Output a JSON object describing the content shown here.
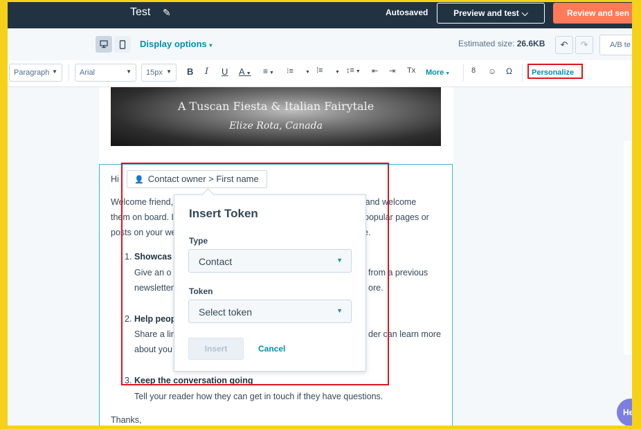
{
  "header": {
    "title": "Test",
    "autosaved": "Autosaved",
    "preview_label": "Preview and test",
    "review_label": "Review and sen"
  },
  "subbar": {
    "display_options": "Display options",
    "estimated_size_label": "Estimated size: ",
    "estimated_size_value": "26.6KB",
    "ab_test": "A/B te"
  },
  "toolbar": {
    "paragraph": "Paragraph",
    "font": "Arial",
    "size": "15px",
    "bold": "B",
    "italic": "I",
    "underline": "U",
    "text_color": "A",
    "more": "More",
    "personalize": "Personalize"
  },
  "hero": {
    "line1": "A Tuscan Fiesta & Italian Fairytale",
    "line2": "Elize Rota, Canada"
  },
  "email": {
    "greeting": "Hi",
    "token_chip": "Contact owner > First name",
    "p1a": "Welcome friend,",
    "p1a_end": "r and welcome",
    "p1b": "them on board. I",
    "p1b_end": "popular pages or",
    "p1c": "posts on your we",
    "p1c_end": "e.",
    "item1_num": "1.",
    "item1_title": "Showcas",
    "item1_a": "Give an o",
    "item1_a_end": "from a previous",
    "item1_b": "newsletter",
    "item1_b_end": "ore.",
    "item2_num": "2.",
    "item2_title": "Help peop",
    "item2_a": "Share a lin",
    "item2_a_end": "der can learn more",
    "item2_b": "about you",
    "item3_num": "3.",
    "item3_title": "Keep the conversation going",
    "item3_a": "Tell your reader how they can get in touch if they have questions.",
    "closing": "Thanks,"
  },
  "popover": {
    "title": "Insert Token",
    "type_label": "Type",
    "type_value": "Contact",
    "token_label": "Token",
    "token_placeholder": "Select token",
    "insert": "Insert",
    "cancel": "Cancel"
  },
  "help": {
    "label": "He"
  },
  "colors": {
    "accent": "#0091ae",
    "nav": "#213343",
    "cta": "#ff7a59",
    "highlight": "#e0141e",
    "border_frame": "#f6d11a"
  }
}
